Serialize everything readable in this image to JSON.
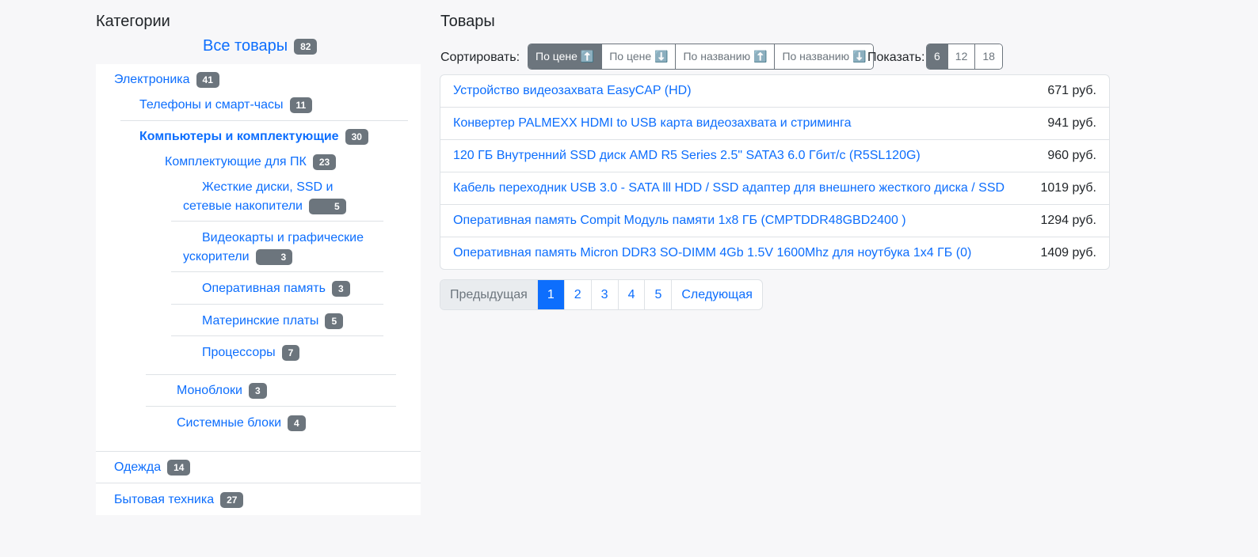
{
  "sidebar": {
    "title": "Категории",
    "all": {
      "label": "Все товары",
      "count": "82"
    },
    "items": [
      {
        "label": "Электроника",
        "count": "41"
      },
      {
        "label": "Телефоны и смарт-часы",
        "count": "11"
      },
      {
        "label": "Компьютеры и комплектующие",
        "count": "30"
      },
      {
        "label": "Комплектующие для ПК",
        "count": "23"
      },
      {
        "label": "Жесткие диски, SSD и сетевые накопители",
        "count": "5"
      },
      {
        "label": "Видеокарты и графические ускорители",
        "count": "3"
      },
      {
        "label": "Оперативная память",
        "count": "3"
      },
      {
        "label": "Материнские платы",
        "count": "5"
      },
      {
        "label": "Процессоры",
        "count": "7"
      },
      {
        "label": "Моноблоки",
        "count": "3"
      },
      {
        "label": "Системные блоки",
        "count": "4"
      },
      {
        "label": "Одежда",
        "count": "14"
      },
      {
        "label": "Бытовая техника",
        "count": "27"
      }
    ]
  },
  "main": {
    "title": "Товары",
    "sort_label": "Сортировать:",
    "sort_options": [
      "По цене ⬆️",
      "По цене ⬇️",
      "По названию ⬆️",
      "По названию ⬇️"
    ],
    "show_label": "Показать:",
    "show_options": [
      "6",
      "12",
      "18"
    ],
    "products": [
      {
        "name": "Устройство видеозахвата EasyCAP (HD)",
        "price": "671 руб."
      },
      {
        "name": "Конвертер PALMEXX HDMI to USB карта видеозахвата и стриминга",
        "price": "941 руб."
      },
      {
        "name": "120 ГБ Внутренний SSD диск AMD R5 Series 2.5\" SATA3 6.0 Гбит/с (R5SL120G)",
        "price": "960 руб."
      },
      {
        "name": "Кабель переходник USB 3.0 - SATA lll HDD / SSD адаптер для внешнего жесткого диска / SSD",
        "price": "1019 руб."
      },
      {
        "name": "Оперативная память Compit Модуль памяти 1x8 ГБ (CMPTDDR48GBD2400 )",
        "price": "1294 руб."
      },
      {
        "name": "Оперативная память Micron DDR3 SO-DIMM 4Gb 1.5V 1600Mhz для ноутбука 1x4 ГБ (0)",
        "price": "1409 руб."
      }
    ],
    "pagination": {
      "prev": "Предыдущая",
      "pages": [
        "1",
        "2",
        "3",
        "4",
        "5"
      ],
      "next": "Следующая"
    }
  },
  "colors": {
    "link": "#0d6efd",
    "badge": "#6c757d",
    "background": "#f7f7f9"
  }
}
